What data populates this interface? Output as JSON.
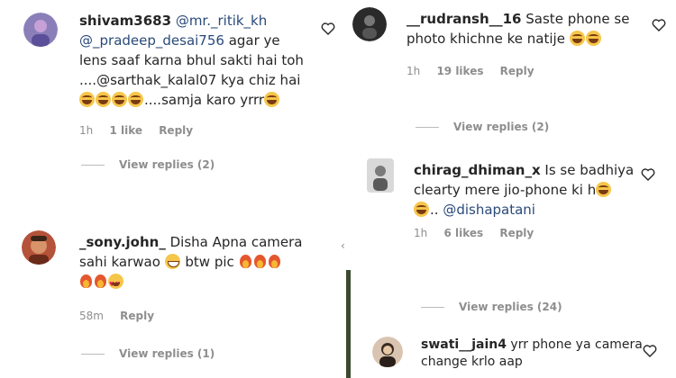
{
  "left_column": [
    {
      "username": "shivam3683",
      "lines": [
        {
          "parts": [
            {
              "t": "mention",
              "v": "@mr._ritik_kh"
            }
          ]
        },
        {
          "parts": [
            {
              "t": "mention",
              "v": "@_pradeep_desai756"
            },
            {
              "t": "text",
              "v": " agar ye"
            }
          ]
        },
        {
          "parts": [
            {
              "t": "text",
              "v": "lens saaf karna bhul sakti hai toh"
            }
          ]
        },
        {
          "parts": [
            {
              "t": "text",
              "v": "....@sarthak_kalal07 kya chiz hai"
            }
          ]
        },
        {
          "parts": [
            {
              "t": "emoji",
              "v": "laugh"
            },
            {
              "t": "emoji",
              "v": "laugh"
            },
            {
              "t": "emoji",
              "v": "laugh"
            },
            {
              "t": "emoji",
              "v": "laugh"
            },
            {
              "t": "text",
              "v": "....samja karo yrrr"
            },
            {
              "t": "emoji",
              "v": "laugh"
            }
          ]
        }
      ],
      "time": "1h",
      "likes": "1 like",
      "reply": "Reply",
      "view_replies": "View replies (2)",
      "avatar_color": "#8a7fb8"
    },
    {
      "username": "_sony.john_",
      "lines": [
        {
          "parts": [
            {
              "t": "text",
              "v": "Disha Apna camera"
            }
          ]
        },
        {
          "parts": [
            {
              "t": "text",
              "v": "sahi karwao "
            },
            {
              "t": "emoji",
              "v": "grin"
            },
            {
              "t": "text",
              "v": " btw pic "
            },
            {
              "t": "emoji",
              "v": "fire"
            },
            {
              "t": "emoji",
              "v": "fire"
            },
            {
              "t": "emoji",
              "v": "fire"
            }
          ]
        },
        {
          "parts": [
            {
              "t": "emoji",
              "v": "fire"
            },
            {
              "t": "emoji",
              "v": "fire"
            },
            {
              "t": "emoji",
              "v": "heart-eyes"
            }
          ]
        }
      ],
      "time": "58m",
      "likes": "",
      "reply": "Reply",
      "view_replies": "View replies (1)",
      "avatar_color": "#b5523a"
    }
  ],
  "right_column": [
    {
      "username": "__rudransh__16",
      "lines": [
        {
          "parts": [
            {
              "t": "text",
              "v": "Saste phone se"
            }
          ]
        },
        {
          "parts": [
            {
              "t": "text",
              "v": "photo khichne ke natije "
            },
            {
              "t": "emoji",
              "v": "laugh"
            },
            {
              "t": "emoji",
              "v": "laugh"
            }
          ]
        }
      ],
      "time": "1h",
      "likes": "19 likes",
      "reply": "Reply",
      "view_replies": "View replies (2)",
      "avatar_color": "#2a2a2a"
    },
    {
      "username": "chirag_dhiman_x",
      "lines": [
        {
          "parts": [
            {
              "t": "text",
              "v": "Is se badhiya"
            }
          ]
        },
        {
          "parts": [
            {
              "t": "text",
              "v": "clearty mere jio-phone ki h"
            },
            {
              "t": "emoji",
              "v": "laugh"
            }
          ]
        },
        {
          "parts": [
            {
              "t": "emoji",
              "v": "laugh"
            },
            {
              "t": "text",
              "v": ".. "
            },
            {
              "t": "mention",
              "v": "@dishapatani"
            }
          ]
        }
      ],
      "time": "1h",
      "likes": "6 likes",
      "reply": "Reply",
      "view_replies": "View replies (24)",
      "avatar_color": "#b9b9b9"
    },
    {
      "username": "swati__jain4",
      "lines": [
        {
          "parts": [
            {
              "t": "text",
              "v": "yrr phone ya camera"
            }
          ]
        },
        {
          "parts": [
            {
              "t": "text",
              "v": "change krlo aap"
            }
          ]
        }
      ],
      "avatar_color": "#d8c4b0"
    }
  ]
}
